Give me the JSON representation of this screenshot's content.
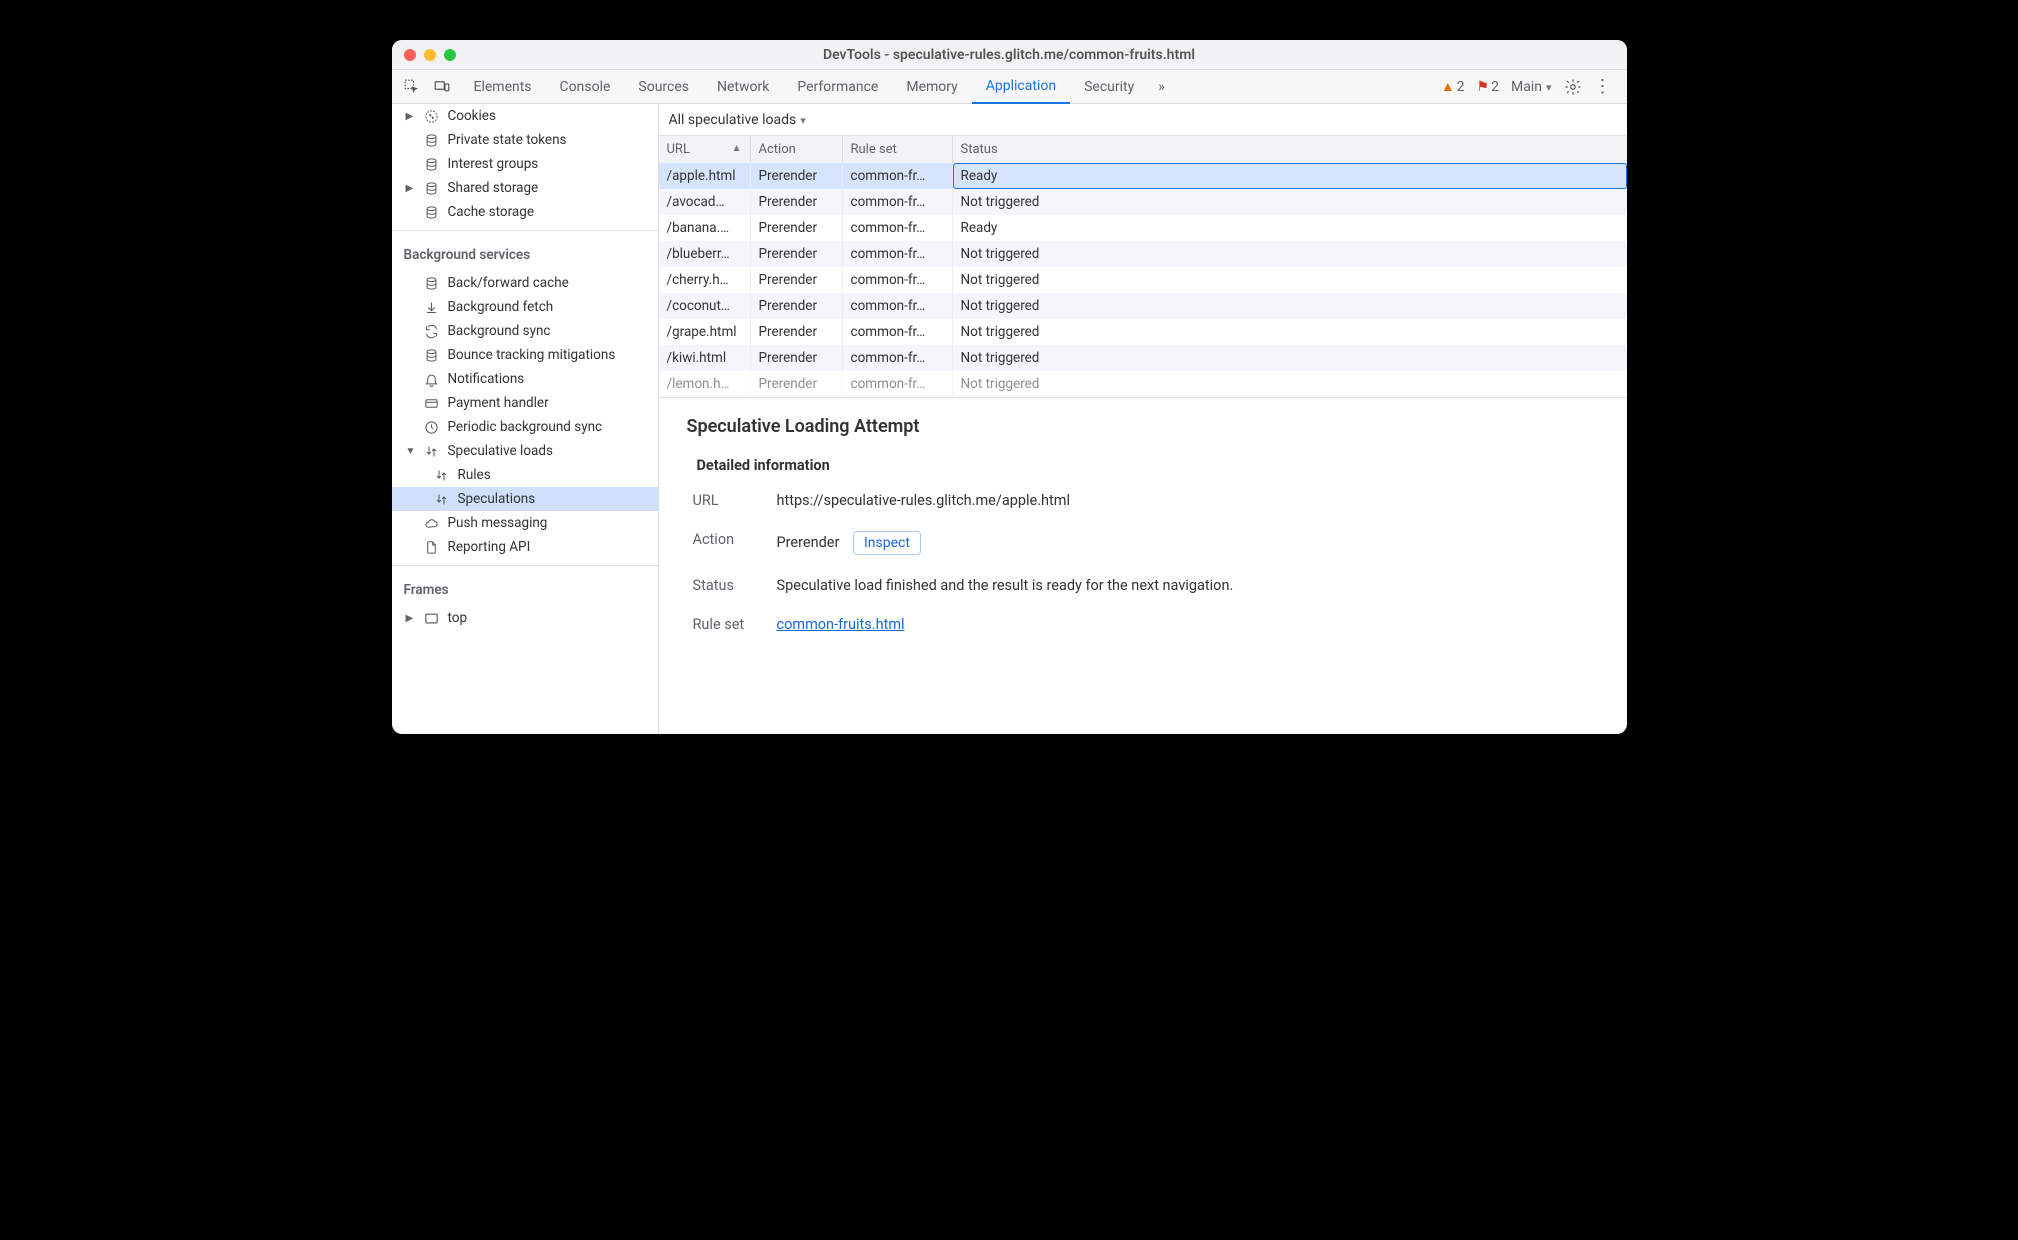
{
  "window_title": "DevTools - speculative-rules.glitch.me/common-fruits.html",
  "tabs": {
    "items": [
      "Elements",
      "Console",
      "Sources",
      "Network",
      "Performance",
      "Memory",
      "Application",
      "Security"
    ],
    "active": "Application"
  },
  "warnings_count": "2",
  "issues_count": "2",
  "context_label": "Main",
  "sidebar": {
    "storage_items": [
      {
        "label": "Cookies",
        "icon": "cookie",
        "caret": true
      },
      {
        "label": "Private state tokens",
        "icon": "db"
      },
      {
        "label": "Interest groups",
        "icon": "db"
      },
      {
        "label": "Shared storage",
        "icon": "db",
        "caret": true
      },
      {
        "label": "Cache storage",
        "icon": "db"
      }
    ],
    "bg_title": "Background services",
    "bg_items": [
      {
        "label": "Back/forward cache",
        "icon": "db"
      },
      {
        "label": "Background fetch",
        "icon": "down"
      },
      {
        "label": "Background sync",
        "icon": "sync"
      },
      {
        "label": "Bounce tracking mitigations",
        "icon": "db"
      },
      {
        "label": "Notifications",
        "icon": "bell"
      },
      {
        "label": "Payment handler",
        "icon": "card"
      },
      {
        "label": "Periodic background sync",
        "icon": "clock"
      },
      {
        "label": "Speculative loads",
        "icon": "spec",
        "expanded": true,
        "children": [
          {
            "label": "Rules",
            "icon": "spec"
          },
          {
            "label": "Speculations",
            "icon": "spec",
            "selected": true
          }
        ]
      },
      {
        "label": "Push messaging",
        "icon": "cloud"
      },
      {
        "label": "Reporting API",
        "icon": "file"
      }
    ],
    "frames_title": "Frames",
    "frames_top_label": "top"
  },
  "filter_label": "All speculative loads",
  "columns": [
    "URL",
    "Action",
    "Rule set",
    "Status"
  ],
  "rows": [
    {
      "url": "/apple.html",
      "action": "Prerender",
      "ruleset": "common-fr…",
      "status": "Ready",
      "selected": true
    },
    {
      "url": "/avocad…",
      "action": "Prerender",
      "ruleset": "common-fr…",
      "status": "Not triggered"
    },
    {
      "url": "/banana.…",
      "action": "Prerender",
      "ruleset": "common-fr…",
      "status": "Ready"
    },
    {
      "url": "/blueberr…",
      "action": "Prerender",
      "ruleset": "common-fr…",
      "status": "Not triggered"
    },
    {
      "url": "/cherry.h…",
      "action": "Prerender",
      "ruleset": "common-fr…",
      "status": "Not triggered"
    },
    {
      "url": "/coconut…",
      "action": "Prerender",
      "ruleset": "common-fr…",
      "status": "Not triggered"
    },
    {
      "url": "/grape.html",
      "action": "Prerender",
      "ruleset": "common-fr…",
      "status": "Not triggered"
    },
    {
      "url": "/kiwi.html",
      "action": "Prerender",
      "ruleset": "common-fr…",
      "status": "Not triggered"
    },
    {
      "url": "/lemon.h…",
      "action": "Prerender",
      "ruleset": "common-fr…",
      "status": "Not triggered",
      "cut": true
    }
  ],
  "detail": {
    "heading": "Speculative Loading Attempt",
    "section": "Detailed information",
    "url_label": "URL",
    "url_value": "https://speculative-rules.glitch.me/apple.html",
    "action_label": "Action",
    "action_value": "Prerender",
    "inspect_label": "Inspect",
    "status_label": "Status",
    "status_value": "Speculative load finished and the result is ready for the next navigation.",
    "ruleset_label": "Rule set",
    "ruleset_link": "common-fruits.html"
  }
}
